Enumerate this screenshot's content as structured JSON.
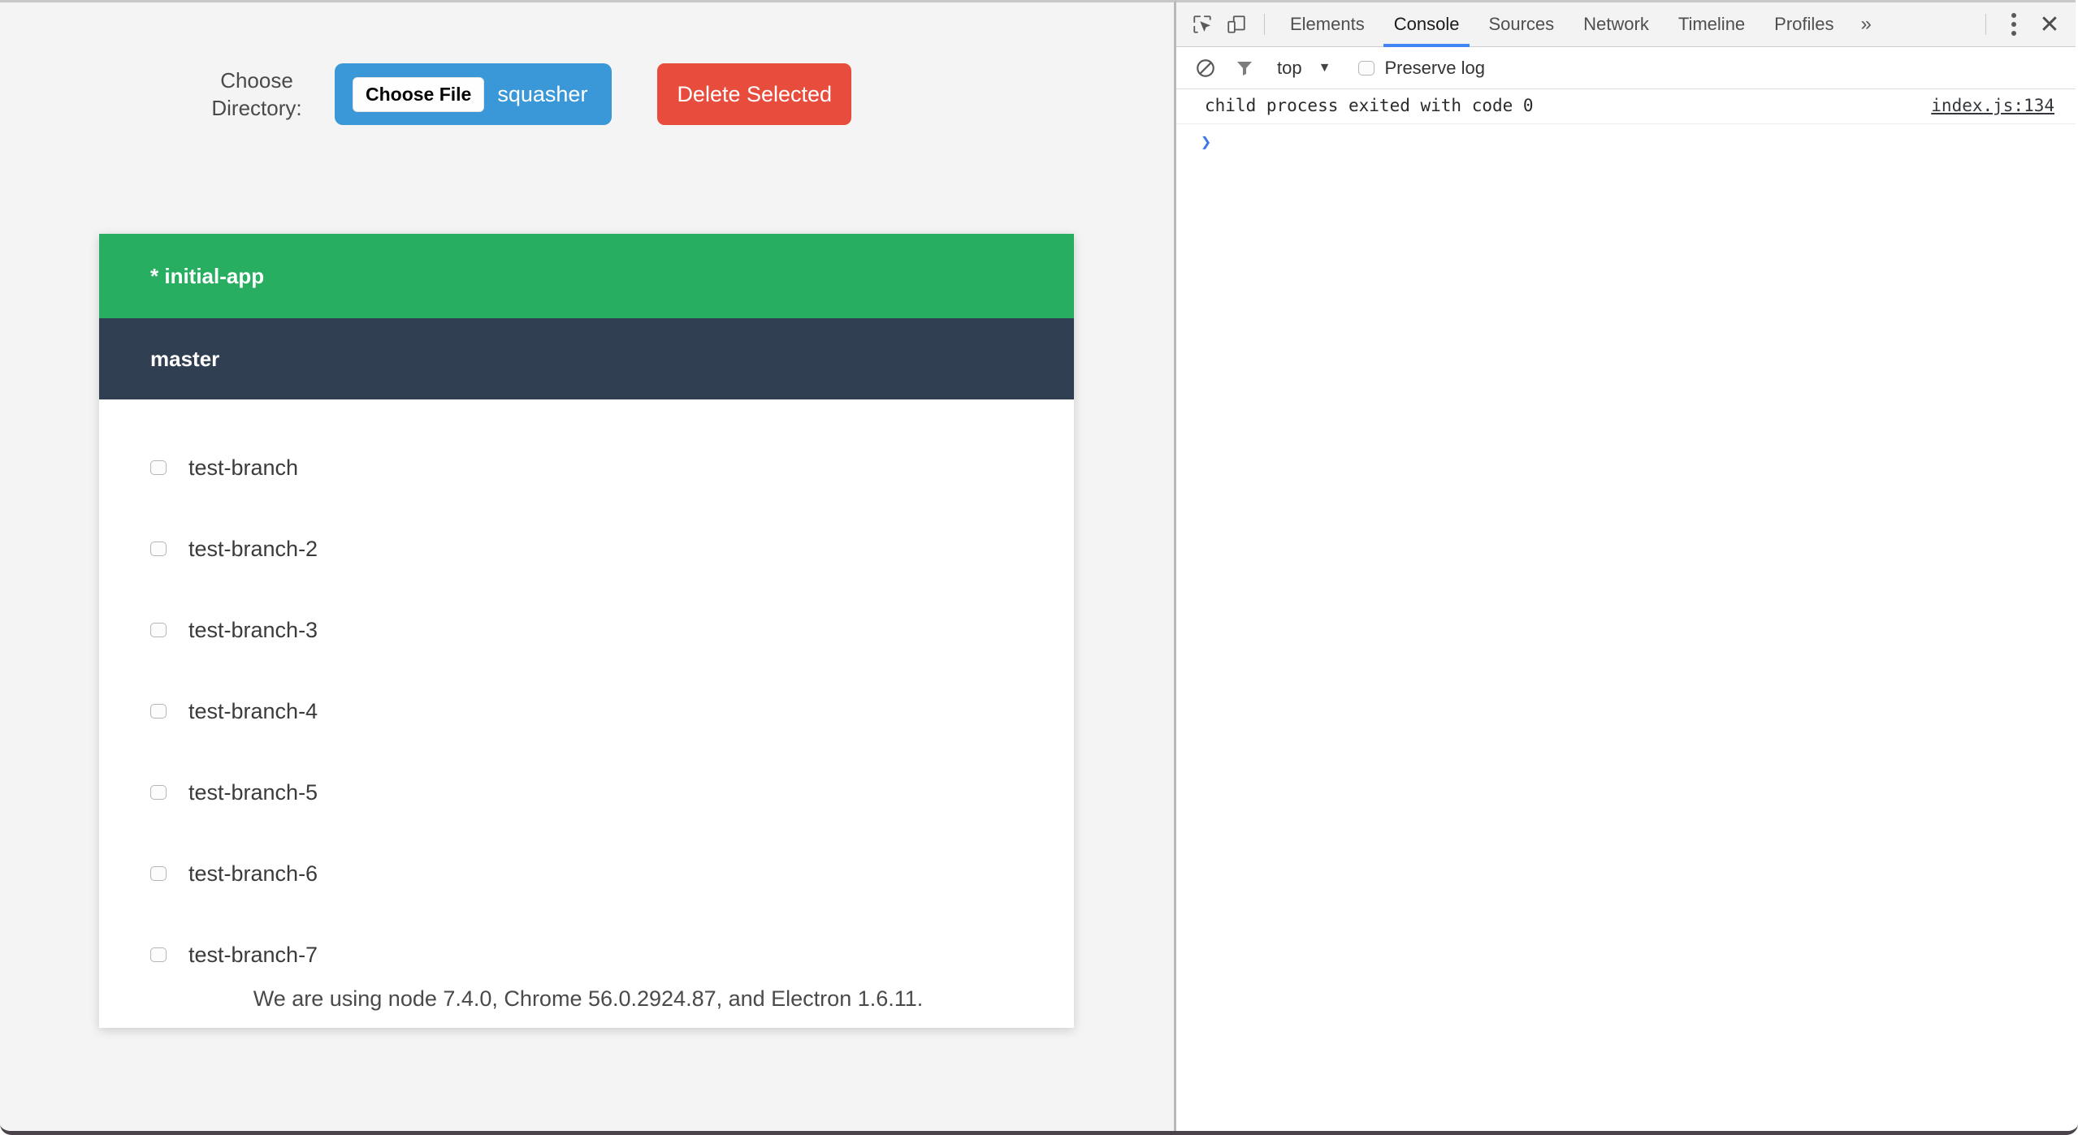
{
  "app": {
    "choose_directory_label": "Choose Directory:",
    "file_input": {
      "button_label": "Choose File",
      "file_name": "squasher"
    },
    "delete_button_label": "Delete Selected",
    "branches": {
      "current": "* initial-app",
      "master": "master",
      "items": [
        {
          "name": "test-branch",
          "checked": false
        },
        {
          "name": "test-branch-2",
          "checked": false
        },
        {
          "name": "test-branch-3",
          "checked": false
        },
        {
          "name": "test-branch-4",
          "checked": false
        },
        {
          "name": "test-branch-5",
          "checked": false
        },
        {
          "name": "test-branch-6",
          "checked": false
        },
        {
          "name": "test-branch-7",
          "checked": false
        }
      ]
    },
    "versions_text": "We are using node 7.4.0, Chrome 56.0.2924.87, and Electron 1.6.11.",
    "colors": {
      "current_branch": "#27ae60",
      "master_branch": "#2f3e50",
      "file_input": "#3a98d8",
      "delete_button": "#e74c3c",
      "background": "#f4f4f4"
    }
  },
  "devtools": {
    "icons": {
      "inspect": "inspect-element-icon",
      "device": "device-toolbar-icon",
      "clear": "clear-console-icon",
      "filter": "filter-icon",
      "more": "»",
      "kebab": "more-options-icon",
      "close": "✕"
    },
    "tabs": [
      {
        "label": "Elements",
        "active": false
      },
      {
        "label": "Console",
        "active": true
      },
      {
        "label": "Sources",
        "active": false
      },
      {
        "label": "Network",
        "active": false
      },
      {
        "label": "Timeline",
        "active": false
      },
      {
        "label": "Profiles",
        "active": false
      }
    ],
    "console_bar": {
      "context": "top",
      "context_arrow": "▼",
      "preserve_log_label": "Preserve log",
      "preserve_log_checked": false
    },
    "console": {
      "messages": [
        {
          "text": "child process exited with code 0",
          "source": "index.js:134"
        }
      ],
      "prompt": "❯"
    },
    "active_tab_color": "#4285f4"
  }
}
